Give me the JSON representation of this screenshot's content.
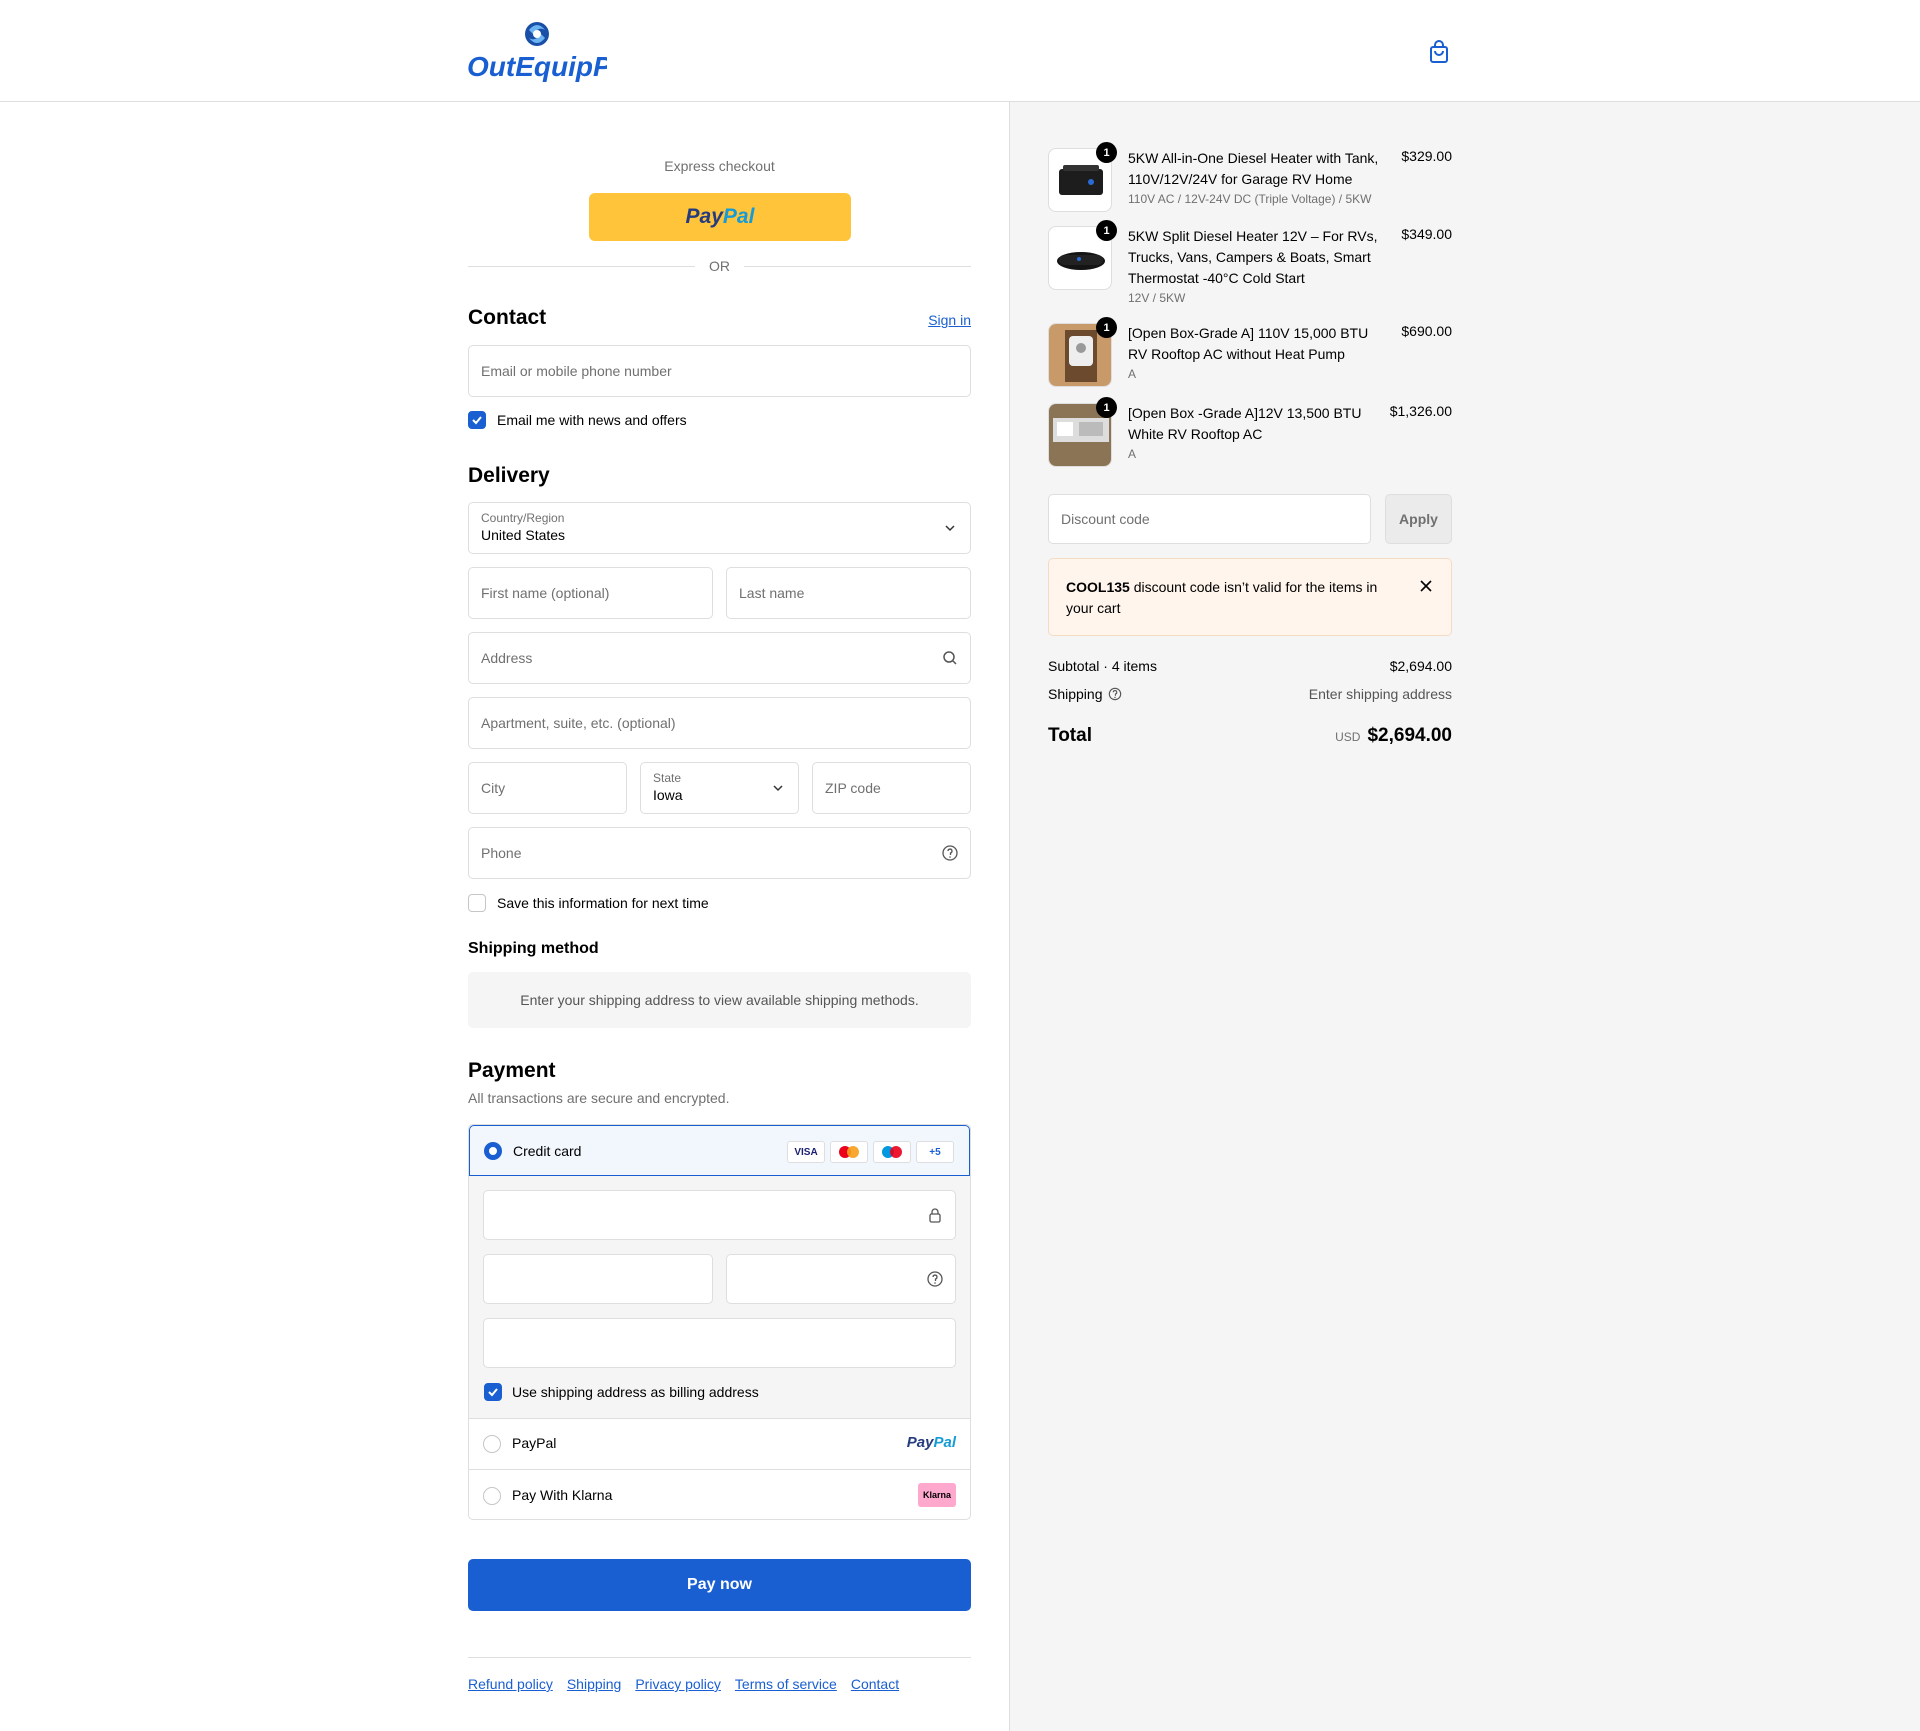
{
  "header": {
    "brand": "OutEquipPro"
  },
  "express": {
    "title": "Express checkout",
    "paypal_brand_a": "Pay",
    "paypal_brand_b": "Pal",
    "or": "OR"
  },
  "contact": {
    "title": "Contact",
    "sign_in": "Sign in",
    "email_placeholder": "Email or mobile phone number",
    "newsletter_label": "Email me with news and offers"
  },
  "delivery": {
    "title": "Delivery",
    "country_label": "Country/Region",
    "country_value": "United States",
    "first_name_placeholder": "First name (optional)",
    "last_name_placeholder": "Last name",
    "address_placeholder": "Address",
    "apartment_placeholder": "Apartment, suite, etc. (optional)",
    "city_placeholder": "City",
    "state_label": "State",
    "state_value": "Iowa",
    "zip_placeholder": "ZIP code",
    "phone_placeholder": "Phone",
    "save_info_label": "Save this information for next time"
  },
  "shipping_method": {
    "title": "Shipping method",
    "notice": "Enter your shipping address to view available shipping methods."
  },
  "payment": {
    "title": "Payment",
    "subtitle": "All transactions are secure and encrypted.",
    "credit_card_label": "Credit card",
    "brands": [
      "VISA",
      "+5"
    ],
    "billing_label": "Use shipping address as billing address",
    "paypal_label": "PayPal",
    "paypal_logo_a": "Pay",
    "paypal_logo_b": "Pal",
    "klarna_label": "Pay With Klarna",
    "klarna_logo": "Klarna",
    "pay_now": "Pay now"
  },
  "footer": {
    "links": [
      "Refund policy",
      "Shipping",
      "Privacy policy",
      "Terms of service",
      "Contact"
    ]
  },
  "cart": {
    "items": [
      {
        "qty": "1",
        "title": "5KW All-in-One Diesel Heater with Tank, 110V/12V/24V for Garage RV Home",
        "variant": "110V AC / 12V-24V DC (Triple Voltage) / 5KW",
        "price": "$329.00"
      },
      {
        "qty": "1",
        "title": "5KW Split Diesel Heater 12V – For RVs, Trucks, Vans, Campers & Boats, Smart Thermostat -40°C Cold Start",
        "variant": "12V / 5KW",
        "price": "$349.00"
      },
      {
        "qty": "1",
        "title": "[Open Box-Grade A] 110V 15,000 BTU RV Rooftop AC without Heat Pump",
        "variant": "A",
        "price": "$690.00"
      },
      {
        "qty": "1",
        "title": "[Open Box -Grade A]12V 13,500 BTU White RV Rooftop AC",
        "variant": "A",
        "price": "$1,326.00"
      }
    ],
    "discount_placeholder": "Discount code",
    "apply": "Apply",
    "error_code": "COOL135",
    "error_text": " discount code isn’t valid for the items in your cart",
    "subtotal_label": "Subtotal · 4 items",
    "subtotal_value": "$2,694.00",
    "shipping_label": "Shipping",
    "shipping_value": "Enter shipping address",
    "total_label": "Total",
    "currency": "USD",
    "total_value": "$2,694.00"
  },
  "colors": {
    "accent": "#1a5fd1",
    "paypal_yellow": "#ffc439",
    "error_bg": "#fff5ec"
  }
}
